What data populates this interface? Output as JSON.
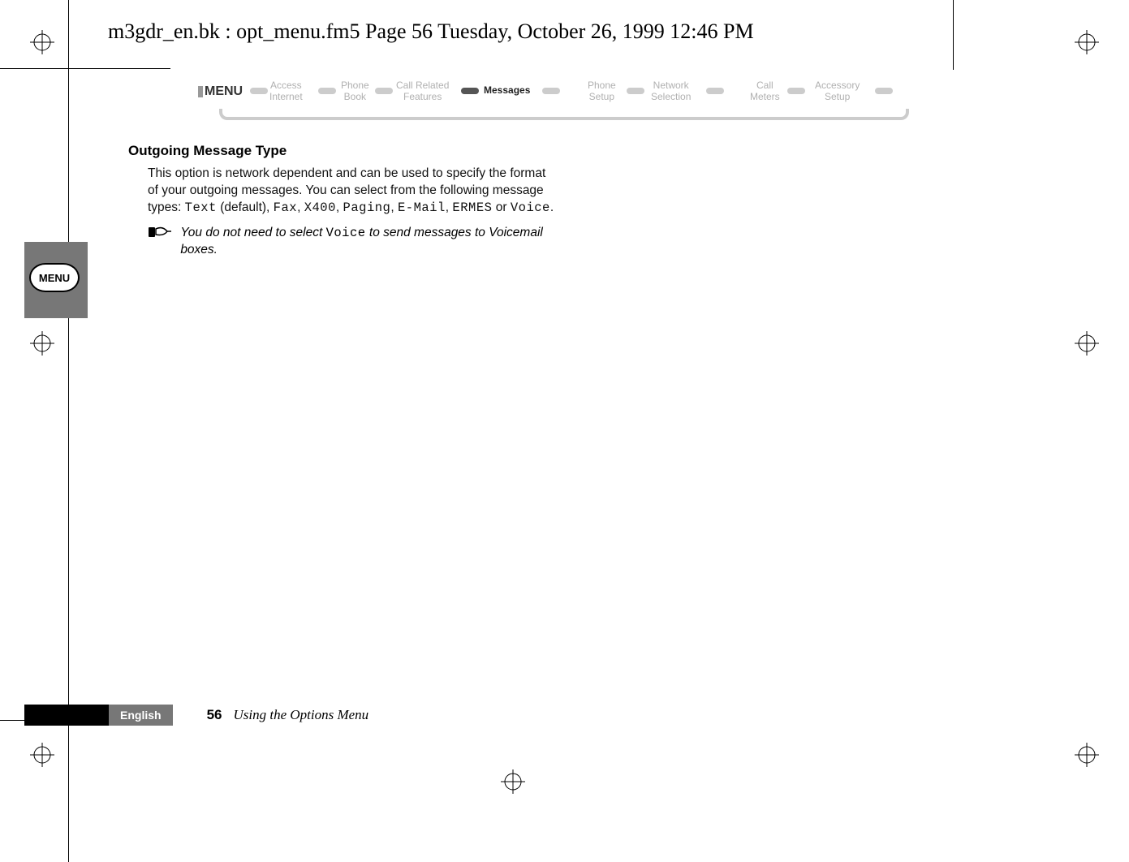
{
  "header": {
    "text": "m3gdr_en.bk : opt_menu.fm5  Page 56  Tuesday, October 26, 1999  12:46 PM"
  },
  "menubar": {
    "label": "MENU",
    "items": [
      {
        "line1": "Access",
        "line2": "Internet"
      },
      {
        "line1": "Phone",
        "line2": "Book"
      },
      {
        "line1": "Call Related",
        "line2": "Features"
      },
      {
        "line1": "Messages",
        "line2": ""
      },
      {
        "line1": "Phone",
        "line2": "Setup"
      },
      {
        "line1": "Network",
        "line2": "Selection"
      },
      {
        "line1": "Call",
        "line2": "Meters"
      },
      {
        "line1": "Accessory",
        "line2": "Setup"
      }
    ]
  },
  "section": {
    "heading": "Outgoing Message Type",
    "para_prefix": "This option is network dependent and can be used to specify the format of your outgoing messages. You can select from the following message types: ",
    "type_text": "Text",
    "default_label": " (default), ",
    "type_fax": "Fax",
    "sep1": ", ",
    "type_x400": "X400",
    "sep2": ", ",
    "type_paging": "Paging",
    "sep3": ", ",
    "type_email": "E-Mail",
    "sep4": ", ",
    "type_ermes": "ERMES",
    "or": " or ",
    "type_voice": "Voice",
    "end": ".",
    "note_prefix": "You do not need to select ",
    "note_voice": "Voice",
    "note_suffix": " to send messages to Voicemail boxes."
  },
  "sidebar": {
    "menu_label": "MENU"
  },
  "footer": {
    "language": "English",
    "page_number": "56",
    "chapter": "Using the Options Menu"
  }
}
